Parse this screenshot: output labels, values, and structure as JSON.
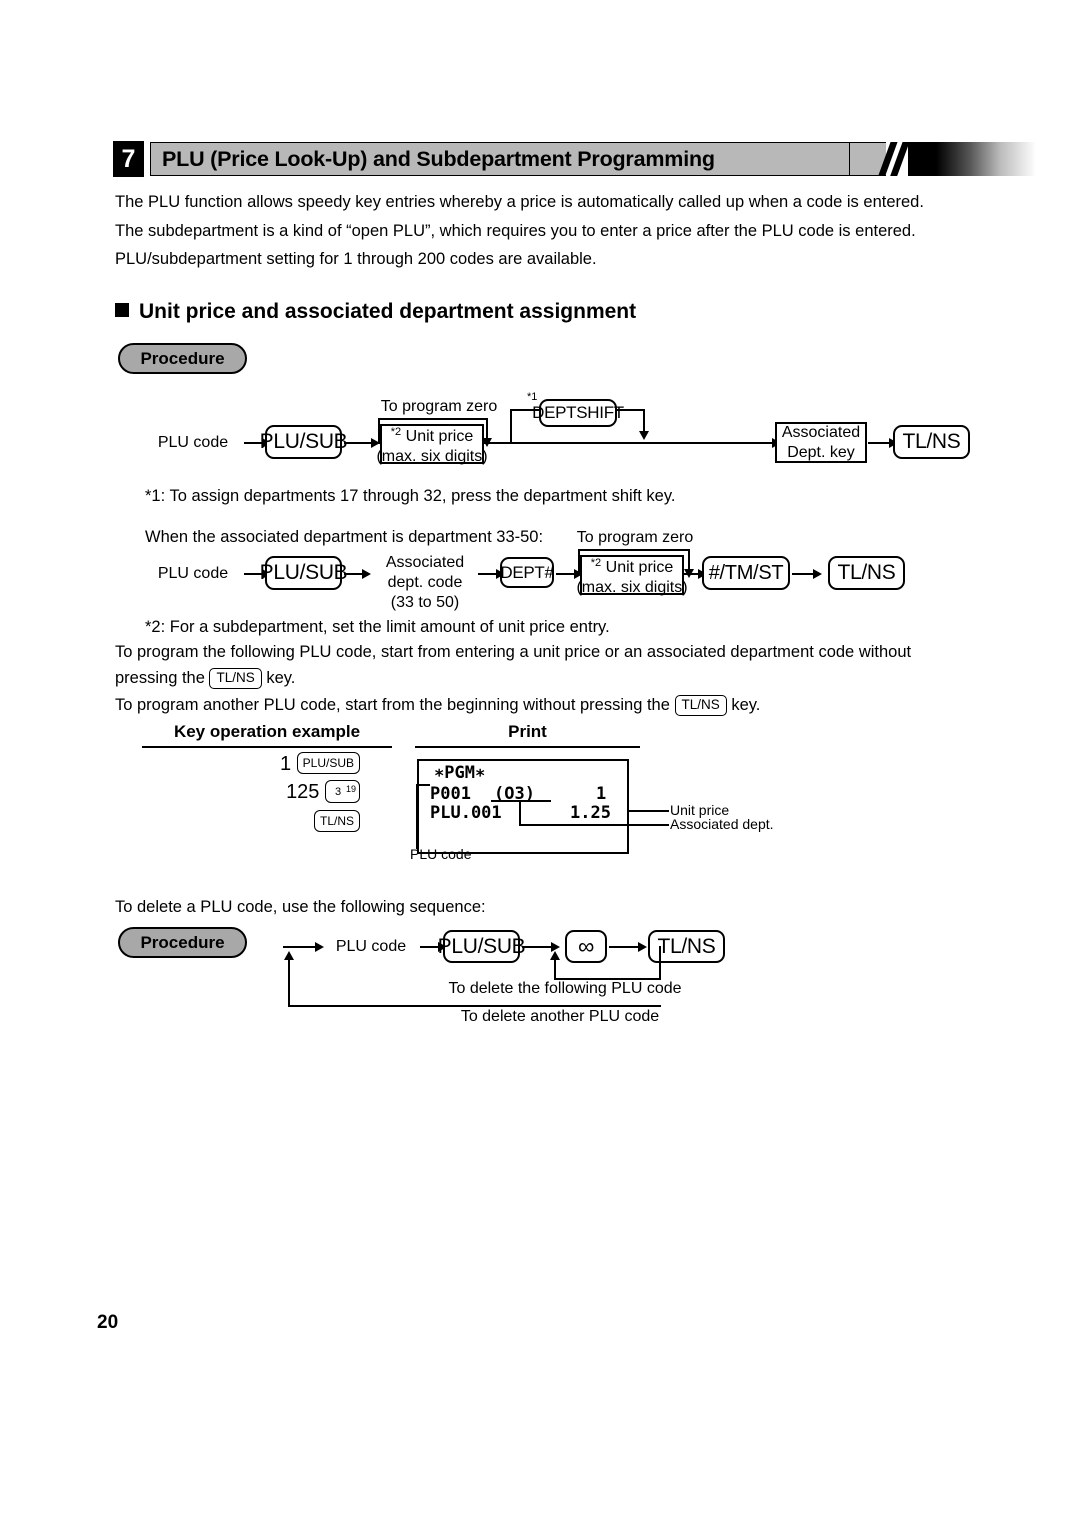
{
  "header": {
    "number": "7",
    "title": "PLU (Price Look-Up) and Subdepartment Programming"
  },
  "intro": {
    "line1": "The PLU function allows speedy key entries whereby a price is automatically called up when a code is entered.",
    "line2": "The subdepartment is a kind of “open PLU”, which requires you to enter a price after the PLU code is entered.",
    "line3": "PLU/subdepartment setting for 1 through 200 codes are available."
  },
  "subheading": "Unit price and associated department assignment",
  "procedure_label": "Procedure",
  "diagram1": {
    "plu_code": "PLU code",
    "plu_sub_key": "PLU/SUB",
    "to_program_zero": "To program zero",
    "unit_price_sup": "*2",
    "unit_price_line1": "Unit price",
    "unit_price_line2": "(max. six digits)",
    "deptshift_sup": "*1",
    "deptshift_key": "DEPTSHIFT",
    "assoc_dept_line1": "Associated",
    "assoc_dept_line2": "Dept. key",
    "tlns_key": "TL/NS"
  },
  "note1": "*1: To assign departments 17 through 32, press the department shift key.",
  "dept33_intro": "When the associated department is department 33-50:",
  "diagram2": {
    "plu_code": "PLU code",
    "plu_sub_key": "PLU/SUB",
    "assoc_code_line1": "Associated",
    "assoc_code_line2": "dept. code",
    "assoc_code_line3": "(33 to 50)",
    "dept_hash_key": "DEPT#",
    "to_program_zero": "To program zero",
    "unit_price_sup": "*2",
    "unit_price_line1": "Unit price",
    "unit_price_line2": "(max. six digits)",
    "tmst_key": "#/TM/ST",
    "tlns_key": "TL/NS"
  },
  "note2": "*2: For a subdepartment, set the limit amount of unit price entry.",
  "paragraphs": {
    "p1_a": "To program the following PLU code, start from entering a unit price or an associated department code without",
    "p1_b_pre": "pressing the",
    "p1_b_key": "TL/NS",
    "p1_b_post": "key.",
    "p2_pre": "To program another PLU code, start from the beginning without pressing the",
    "p2_key": "TL/NS",
    "p2_post": "key."
  },
  "example": {
    "keyop_header": "Key operation example",
    "print_header": "Print",
    "rows": [
      {
        "value": "1",
        "key": "PLU/SUB",
        "key_sup": ""
      },
      {
        "value": "125",
        "key": "3",
        "key_sup": "19"
      },
      {
        "value": "",
        "key": "TL/NS",
        "key_sup": ""
      }
    ],
    "receipt": {
      "title": "∗PGM∗",
      "line2_left": "P001",
      "line2_mid": "(O3)",
      "line2_right": "1",
      "line3_left": "PLU.001",
      "line3_right": "1.25"
    },
    "callouts": {
      "unit_price": "Unit price",
      "associated_dept": "Associated dept.",
      "plu_code": "PLU code"
    }
  },
  "delete": {
    "intro": "To delete a PLU code, use the following sequence:",
    "procedure_label": "Procedure",
    "plu_code": "PLU code",
    "plu_sub_key": "PLU/SUB",
    "infinity_key": "∞",
    "tlns_key": "TL/NS",
    "loop1": "To delete the following PLU code",
    "loop2": "To delete another PLU code"
  },
  "page_number": "20"
}
